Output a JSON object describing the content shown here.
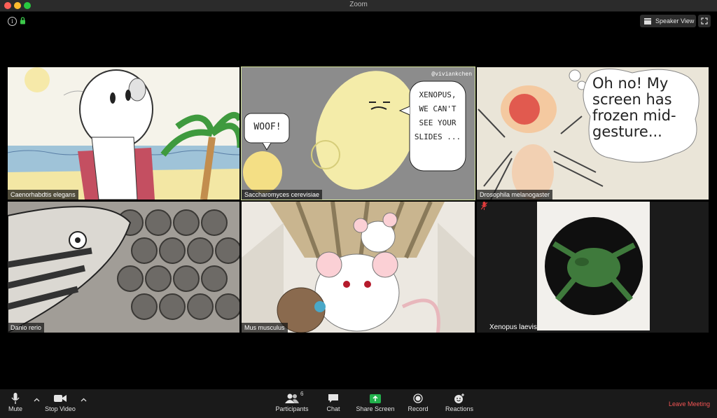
{
  "window": {
    "title": "Zoom"
  },
  "top": {
    "view_label": "Speaker View"
  },
  "participants": [
    {
      "name": "Caenorhabdtis elegans"
    },
    {
      "name": "Saccharomyces cerevisiae",
      "watermark": "@viviankchen",
      "bubble_woof": "WOOF!",
      "bubble_main": "XENOPUS, WE CAN'T SEE YOUR SLIDES ..."
    },
    {
      "name": "Drosophila melanogaster",
      "bubble": "Oh no! My screen has frozen mid-gesture..."
    },
    {
      "name": "Danio rerio"
    },
    {
      "name": "Mus musculus"
    },
    {
      "name": "Xenopus laevis",
      "muted": true
    }
  ],
  "toolbar": {
    "mute_label": "Mute",
    "stop_video_label": "Stop Video",
    "participants_label": "Participants",
    "participants_count": "6",
    "chat_label": "Chat",
    "share_label": "Share Screen",
    "record_label": "Record",
    "reactions_label": "Reactions",
    "leave_label": "Leave Meeting"
  },
  "colors": {
    "accent_green": "#d3e29a",
    "leave_red": "#f25454",
    "share_green": "#22b14c"
  }
}
